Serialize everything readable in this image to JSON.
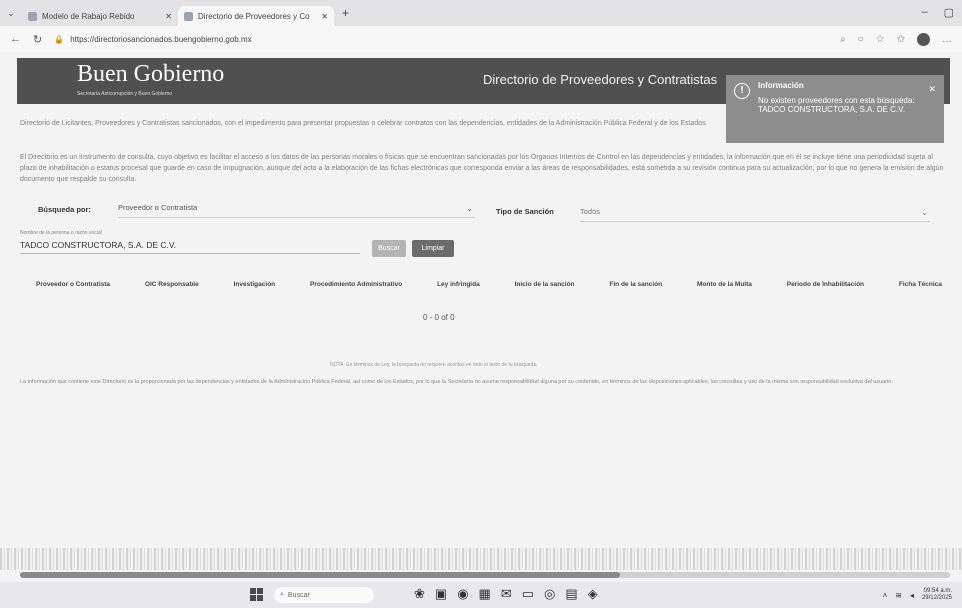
{
  "browser": {
    "tabs": [
      {
        "title": "Modelo de Rabajo Rebido",
        "active": false
      },
      {
        "title": "Directorio de Proveedores y Co",
        "active": true
      }
    ],
    "url": "https://directoriosancionados.buengobierno.gob.mx"
  },
  "header": {
    "logo": "Buen Gobierno",
    "logo_sub": "Secretaría Anticorrupción y Buen Gobierno",
    "title": "Directorio de Proveedores y Contratistas"
  },
  "toast": {
    "title": "Información",
    "message": "No existen proveedores con esta búsqueda: TADCO CONSTRUCTORA, S.A. DE C.V."
  },
  "intro": {
    "p1": "Directorio de Licitantes, Proveedores y Contratistas sancionados, con el impedimento para presentar propuestas o celebrar contratos con las dependencias, entidades de la Administración Pública Federal y de los Estados.",
    "p2": "El Directorio es un instrumento de consulta, cuyo objetivo es facilitar el acceso a los datos de las personas morales o físicas que se encuentran sancionadas por los Órganos Internos de Control en las dependencias y entidades, la información que en él se incluye tiene una periodicidad sujeta al plazo de inhabilitación o estatus procesal que guarde en caso de impugnación, aunque del acto a la elaboración de las fichas electrónicas que corresponda enviar a las áreas de responsabilidades, está sometida a su revisión continua para su actualización, por lo que no genera la emisión de algún documento que respalde su consulta."
  },
  "search": {
    "label": "Búsqueda por:",
    "by_value": "Proveedor o Contratista",
    "sanction_label": "Tipo de Sanción",
    "sanction_value": "Todos",
    "input_label": "Nombre de la persona o razón social",
    "input_value": "TADCO CONSTRUCTORA, S.A. DE C.V.",
    "search_btn": "Buscar",
    "clear_btn": "Limpiar"
  },
  "table": {
    "columns": [
      "Proveedor o Contratista",
      "OIC Responsable",
      "Investigación",
      "Procedimiento Administrativo",
      "Ley infringida",
      "Inicio de la sanción",
      "Fin de la sanción",
      "Monto de la Multa",
      "Periodo de Inhabilitación",
      "Ficha Técnica"
    ],
    "pager": "0 - 0 of 0"
  },
  "notes": {
    "small": "NOTA: En términos de Ley, la búsqueda no requiere acentos en todo el texto de tu búsqueda.",
    "footnote": "La información que contiene este Directorio es la proporcionada por las dependencias y entidades de la Administración Pública Federal, así como de los Estados, por lo que la Secretaría no asume responsabilidad alguna por su contenido, en términos de las disposiciones aplicables; las consultas y uso de la misma son responsabilidad exclusiva del usuario."
  },
  "taskbar": {
    "search_placeholder": "Buscar",
    "clock_time": "09:54 a.m.",
    "clock_date": "29/12/2025"
  },
  "colors": {
    "header_bg": "#505050",
    "toast_bg": "#8d8d8d",
    "page_bg": "#f3f3f3"
  }
}
